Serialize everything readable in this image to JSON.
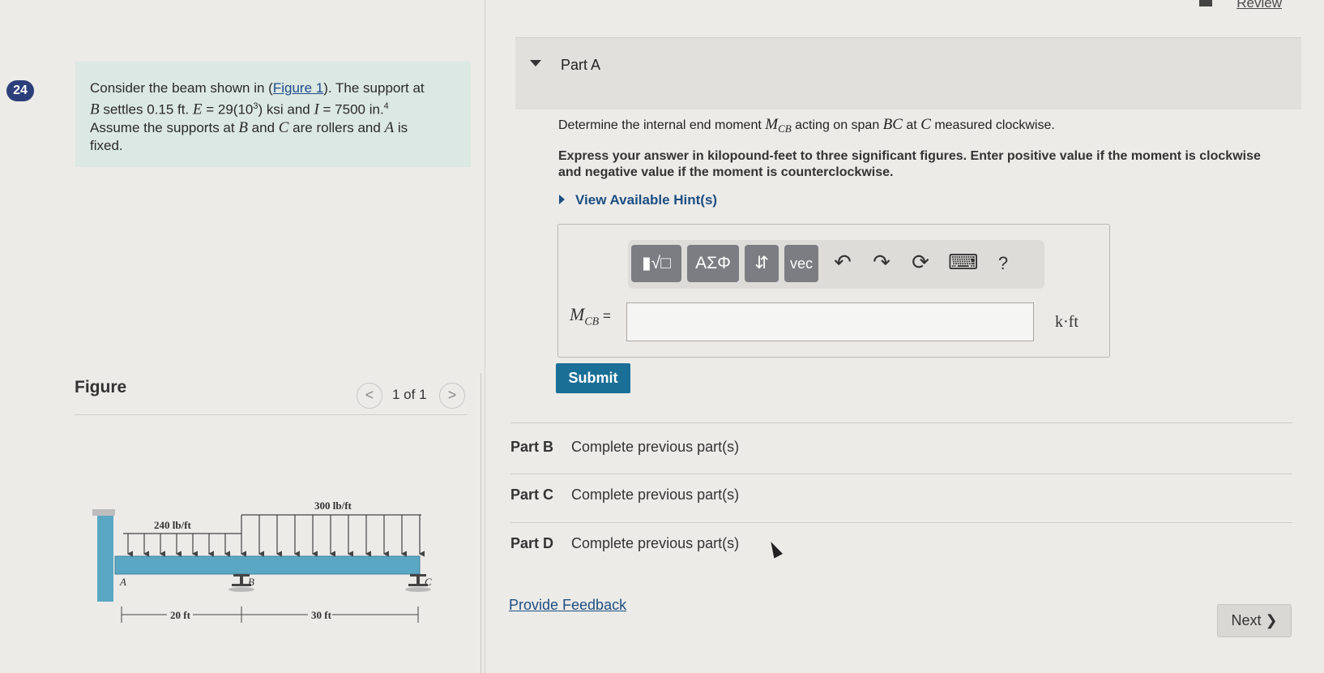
{
  "header": {
    "review_label": "Review"
  },
  "question_number": "24",
  "problem": {
    "p1": "Consider the beam shown in (",
    "figure_link": "Figure 1",
    "p2": "). The support at",
    "p3": "B",
    "p4": " settles 0.15 ft. ",
    "p5": "E",
    "p6": " = 29(10",
    "p6sup": "3",
    "p7": ") ksi and ",
    "p8": "I",
    "p9": " = 7500 in.",
    "p9sup": "4",
    "p10": "Assume the supports at ",
    "p11": "B",
    "p12": " and ",
    "p13": "C",
    "p14": " are rollers and ",
    "p15": "A",
    "p16": " is",
    "p17": "fixed."
  },
  "figure": {
    "title": "Figure",
    "prev": "<",
    "next": ">",
    "count": "1 of 1",
    "load_left": "240 lb/ft",
    "load_right": "300 lb/ft",
    "label_A": "A",
    "label_B": "B",
    "label_C": "C",
    "span1": "20 ft",
    "span2": "30 ft"
  },
  "partA": {
    "title": "Part A",
    "q1": "Determine the internal end moment ",
    "q_var": "M",
    "q_sub": "CB",
    "q2": " acting on span ",
    "q_span": "BC",
    "q3": " at ",
    "q_c": "C",
    "q4": " measured clockwise.",
    "instructions": "Express your answer in kilopound-feet to three significant figures. Enter positive value if the moment is clockwise and negative value if the moment is counterclockwise.",
    "hint_label": "View Available Hint(s)",
    "toolbar": {
      "templates": "▮√□",
      "greek": "ΑΣΦ",
      "arrows": "⇵",
      "vec": "vec",
      "undo": "↶",
      "redo": "↷",
      "reset": "⟳",
      "keyboard": "⌨",
      "help": "?"
    },
    "lhs_var": "M",
    "lhs_sub": "CB",
    "lhs_eq": " =",
    "answer_value": "",
    "unit": "k·ft",
    "submit_label": "Submit"
  },
  "parts": [
    {
      "label": "Part B",
      "status": "Complete previous part(s)"
    },
    {
      "label": "Part C",
      "status": "Complete previous part(s)"
    },
    {
      "label": "Part D",
      "status": "Complete previous part(s)"
    }
  ],
  "footer": {
    "feedback_label": "Provide Feedback",
    "next_label": "Next ❯"
  }
}
